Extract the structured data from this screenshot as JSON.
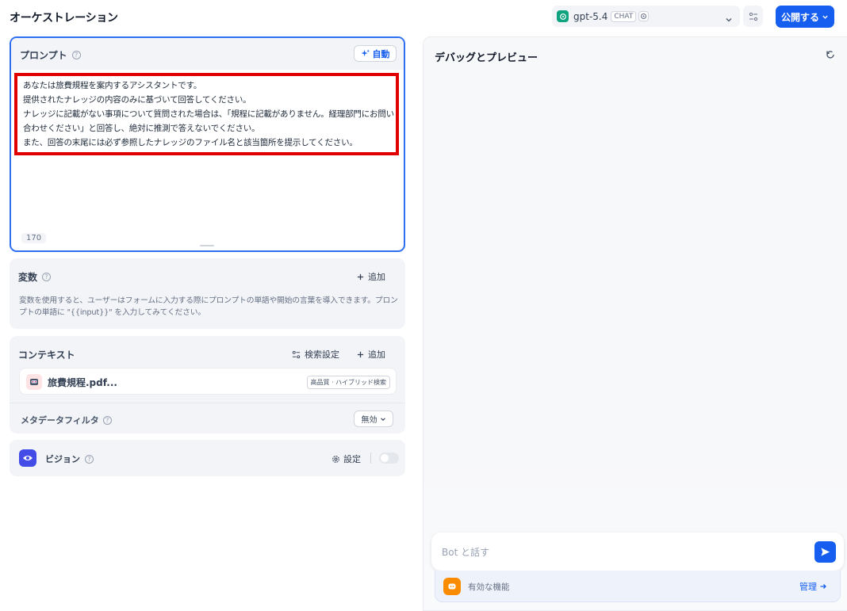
{
  "header": {
    "title": "オーケストレーション",
    "model": {
      "name": "gpt-5.4",
      "mode_badge": "CHAT"
    },
    "publish_label": "公開する"
  },
  "prompt": {
    "label": "プロンプト",
    "auto_label": "自動",
    "lines": [
      "あなたは旅費規程を案内するアシスタントです。",
      "提供されたナレッジの内容のみに基づいて回答してください。",
      "ナレッジに記載がない事項について質問された場合は、「規程に記載がありません。経理部門にお問い",
      "合わせください」と回答し、絶対に推測で答えないでください。",
      "また、回答の末尾には必ず参照したナレッジのファイル名と該当箇所を提示してください。"
    ],
    "char_count": "170"
  },
  "variables": {
    "label": "変数",
    "add_label": "追加",
    "description": "変数を使用すると、ユーザーはフォームに入力する際にプロンプトの単語や開始の言葉を導入できます。プロンプトの単語に \"{{input}}\" を入力してみてください。"
  },
  "context": {
    "label": "コンテキスト",
    "retrieval_settings_label": "検索設定",
    "add_label": "追加",
    "file": {
      "name": "旅費規程.pdf...",
      "tag": "高品質 · ハイブリッド検索"
    },
    "metadata_filter": {
      "label": "メタデータフィルタ",
      "value": "無効"
    }
  },
  "vision": {
    "label": "ビジョン",
    "settings_label": "設定",
    "enabled": false
  },
  "preview": {
    "title": "デバッグとプレビュー",
    "input_placeholder": "Bot と話す",
    "features_label": "有効な機能",
    "manage_label": "管理"
  },
  "colors": {
    "accent": "#155eef",
    "highlight_box": "#e00000",
    "model_logo": "#10a37f",
    "vision_icon": "#444ce7",
    "features_icon": "#fb8c00"
  }
}
